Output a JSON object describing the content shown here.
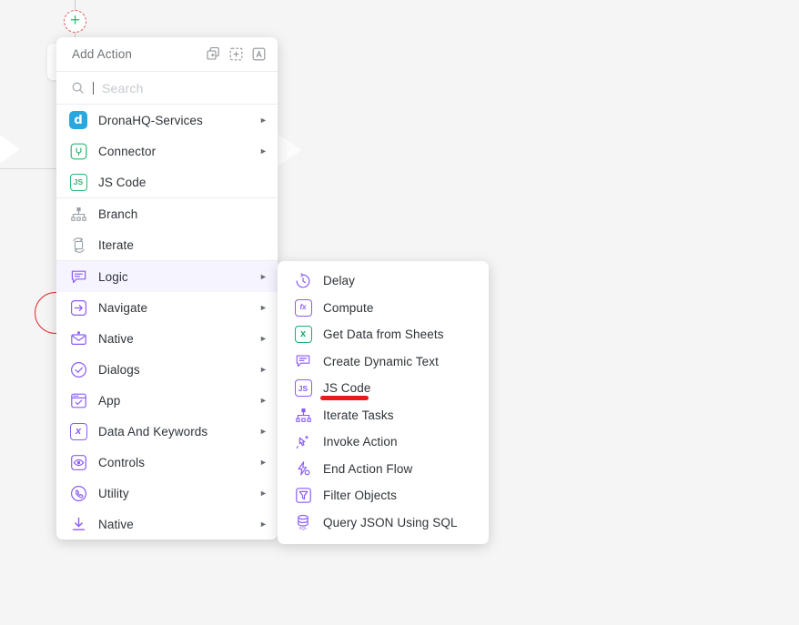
{
  "menu": {
    "header": {
      "title": "Add Action",
      "icons": [
        {
          "name": "duplicate-add-icon",
          "label": "Duplicate Action"
        },
        {
          "name": "add-dashed-box-icon",
          "label": "Add Group"
        },
        {
          "name": "annotate-text-icon",
          "label": "Add Note"
        }
      ]
    },
    "search": {
      "placeholder": "Search",
      "value": "",
      "icon": "search-icon"
    },
    "groups": [
      {
        "items": [
          {
            "label": "DronaHQ-Services",
            "icon": "dronahq-logo-icon",
            "icon_style": "brand",
            "icon_color": "#29a8e0",
            "has_submenu": true,
            "selected": false
          },
          {
            "label": "Connector",
            "icon": "plug-connector-icon",
            "icon_style": "outline",
            "icon_color": "#2bb673",
            "has_submenu": true,
            "selected": false
          },
          {
            "label": "JS Code",
            "icon": "js-code-icon",
            "icon_style": "outline",
            "icon_color": "#2bb673",
            "has_submenu": false,
            "selected": false
          }
        ]
      },
      {
        "items": [
          {
            "label": "Branch",
            "icon": "branch-tree-icon",
            "icon_style": "plain",
            "icon_color": "#9aa0a6",
            "has_submenu": false,
            "selected": false
          },
          {
            "label": "Iterate",
            "icon": "iterate-loop-icon",
            "icon_style": "plain",
            "icon_color": "#9aa0a6",
            "has_submenu": false,
            "selected": false
          }
        ]
      },
      {
        "items": [
          {
            "label": "Logic",
            "icon": "logic-message-icon",
            "icon_style": "plain",
            "icon_color": "#8b5cf6",
            "has_submenu": true,
            "selected": true
          },
          {
            "label": "Navigate",
            "icon": "navigate-arrow-icon",
            "icon_style": "outline",
            "icon_color": "#8b5cf6",
            "has_submenu": true,
            "selected": false
          },
          {
            "label": "Native",
            "icon": "native-mail-icon",
            "icon_style": "plain",
            "icon_color": "#8b5cf6",
            "has_submenu": true,
            "selected": false
          },
          {
            "label": "Dialogs",
            "icon": "dialogs-check-circle-icon",
            "icon_style": "plain",
            "icon_color": "#8b5cf6",
            "has_submenu": true,
            "selected": false
          },
          {
            "label": "App",
            "icon": "app-window-icon",
            "icon_style": "outline",
            "icon_color": "#8b5cf6",
            "has_submenu": true,
            "selected": false
          },
          {
            "label": "Data And Keywords",
            "icon": "data-keywords-x-icon",
            "icon_style": "outline",
            "icon_color": "#8b5cf6",
            "has_submenu": true,
            "selected": false
          },
          {
            "label": "Controls",
            "icon": "controls-eye-icon",
            "icon_style": "outline",
            "icon_color": "#8b5cf6",
            "has_submenu": true,
            "selected": false
          },
          {
            "label": "Utility",
            "icon": "utility-phone-icon",
            "icon_style": "plain",
            "icon_color": "#8b5cf6",
            "has_submenu": true,
            "selected": false
          },
          {
            "label": "Native",
            "icon": "download-arrow-icon",
            "icon_style": "plain",
            "icon_color": "#8b5cf6",
            "has_submenu": true,
            "selected": false
          }
        ]
      }
    ]
  },
  "submenu": {
    "parent": "Logic",
    "items": [
      {
        "label": "Delay",
        "icon": "delay-clock-icon",
        "icon_color": "#8b5cf6"
      },
      {
        "label": "Compute",
        "icon": "compute-fx-icon",
        "icon_color": "#8b5cf6"
      },
      {
        "label": "Get Data from Sheets",
        "icon": "sheets-x-icon",
        "icon_color": "#1aab72"
      },
      {
        "label": "Create Dynamic Text",
        "icon": "dynamic-text-icon",
        "icon_color": "#8b5cf6"
      },
      {
        "label": "JS Code",
        "icon": "js-code-icon",
        "icon_color": "#8b5cf6"
      },
      {
        "label": "Iterate Tasks",
        "icon": "iterate-tasks-tree-icon",
        "icon_color": "#8b5cf6"
      },
      {
        "label": "Invoke Action",
        "icon": "invoke-action-click-icon",
        "icon_color": "#8b5cf6"
      },
      {
        "label": "End Action Flow",
        "icon": "end-action-flow-bolt-icon",
        "icon_color": "#8b5cf6"
      },
      {
        "label": "Filter Objects",
        "icon": "filter-funnel-icon",
        "icon_color": "#8b5cf6"
      },
      {
        "label": "Query JSON Using SQL",
        "icon": "database-sql-icon",
        "icon_color": "#8b5cf6"
      }
    ]
  },
  "canvas": {
    "add_node": {
      "name": "add-node-button",
      "glyph": "+",
      "border_color": "#e05a5a",
      "glyph_color": "#30c07a"
    },
    "annotations": [
      {
        "name": "red-underline-annotation",
        "color": "#e81a1a",
        "target": "JS Code"
      },
      {
        "name": "red-circle-annotation",
        "color": "#e03030"
      }
    ],
    "background_color": "#f5f5f5"
  }
}
